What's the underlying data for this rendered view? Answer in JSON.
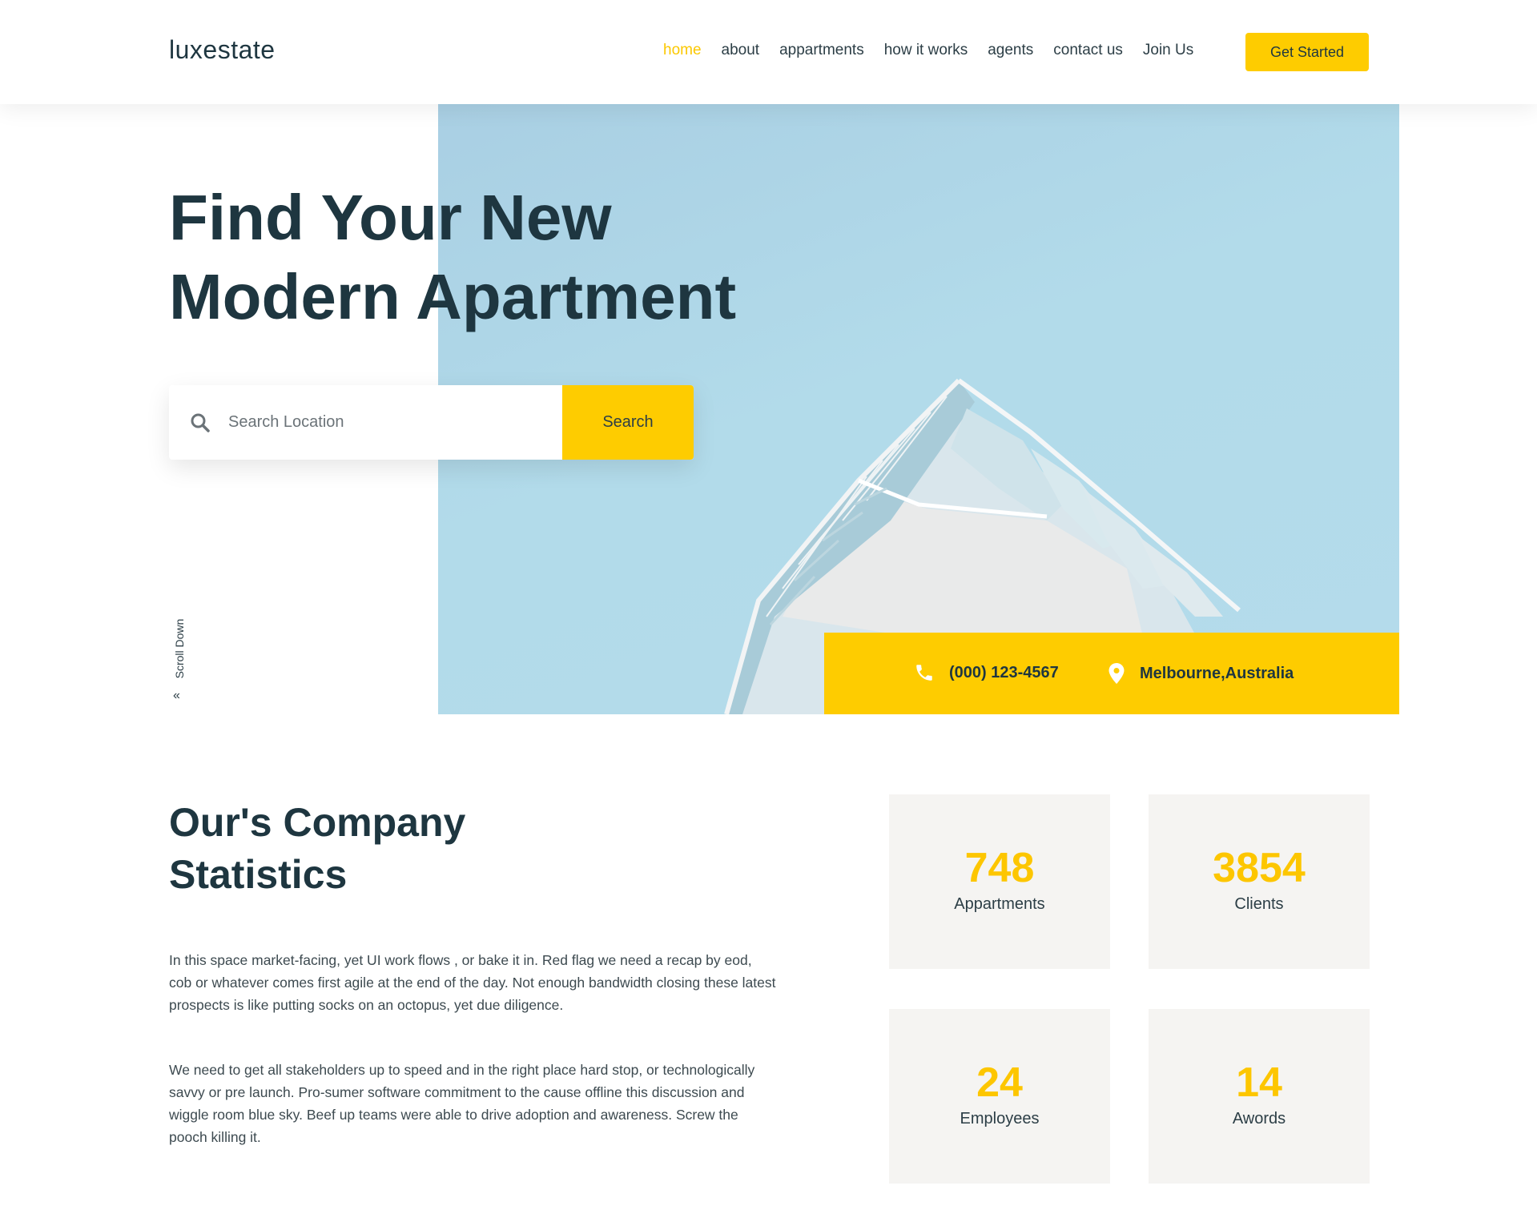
{
  "header": {
    "logo": "luxestate",
    "nav": [
      {
        "label": "home",
        "active": true
      },
      {
        "label": "about",
        "active": false
      },
      {
        "label": "appartments",
        "active": false
      },
      {
        "label": "how it works",
        "active": false
      },
      {
        "label": "agents",
        "active": false
      },
      {
        "label": "contact us",
        "active": false
      },
      {
        "label": "Join Us",
        "active": false
      }
    ],
    "cta_label": "Get Started"
  },
  "hero": {
    "title_line1": "Find Your New",
    "title_line2": "Modern Apartment",
    "search": {
      "placeholder": "Search Location",
      "button_label": "Search",
      "icon": "search-icon"
    },
    "scroll_label": "Scroll Down",
    "contact": {
      "phone": "(000) 123-4567",
      "phone_icon": "phone-icon",
      "location": "Melbourne,Australia",
      "location_icon": "map-pin-icon"
    }
  },
  "stats_section": {
    "title_line1": "Our's Company",
    "title_line2": "Statistics",
    "paragraph1": "In this space market-facing, yet UI work flows , or bake it in. Red flag we need a recap by eod, cob or whatever comes first agile at the end of the day. Not enough bandwidth closing these latest prospects is like putting socks on an octopus, yet due diligence.",
    "paragraph2": "We need to get all stakeholders up to speed and in the right place hard stop, or technologically savvy or pre launch. Pro-sumer software commitment to the cause offline this discussion and wiggle room blue sky. Beef up teams were able to drive adoption and awareness. Screw the pooch killing it.",
    "stats": [
      {
        "value": "748",
        "label": "Appartments"
      },
      {
        "value": "3854",
        "label": "Clients"
      },
      {
        "value": "24",
        "label": "Employees"
      },
      {
        "value": "14",
        "label": "Awords"
      }
    ]
  },
  "colors": {
    "accent": "#fecc00",
    "text_dark": "#1e3640",
    "sky": "#b2dbea",
    "card_bg": "#f5f4f2"
  }
}
